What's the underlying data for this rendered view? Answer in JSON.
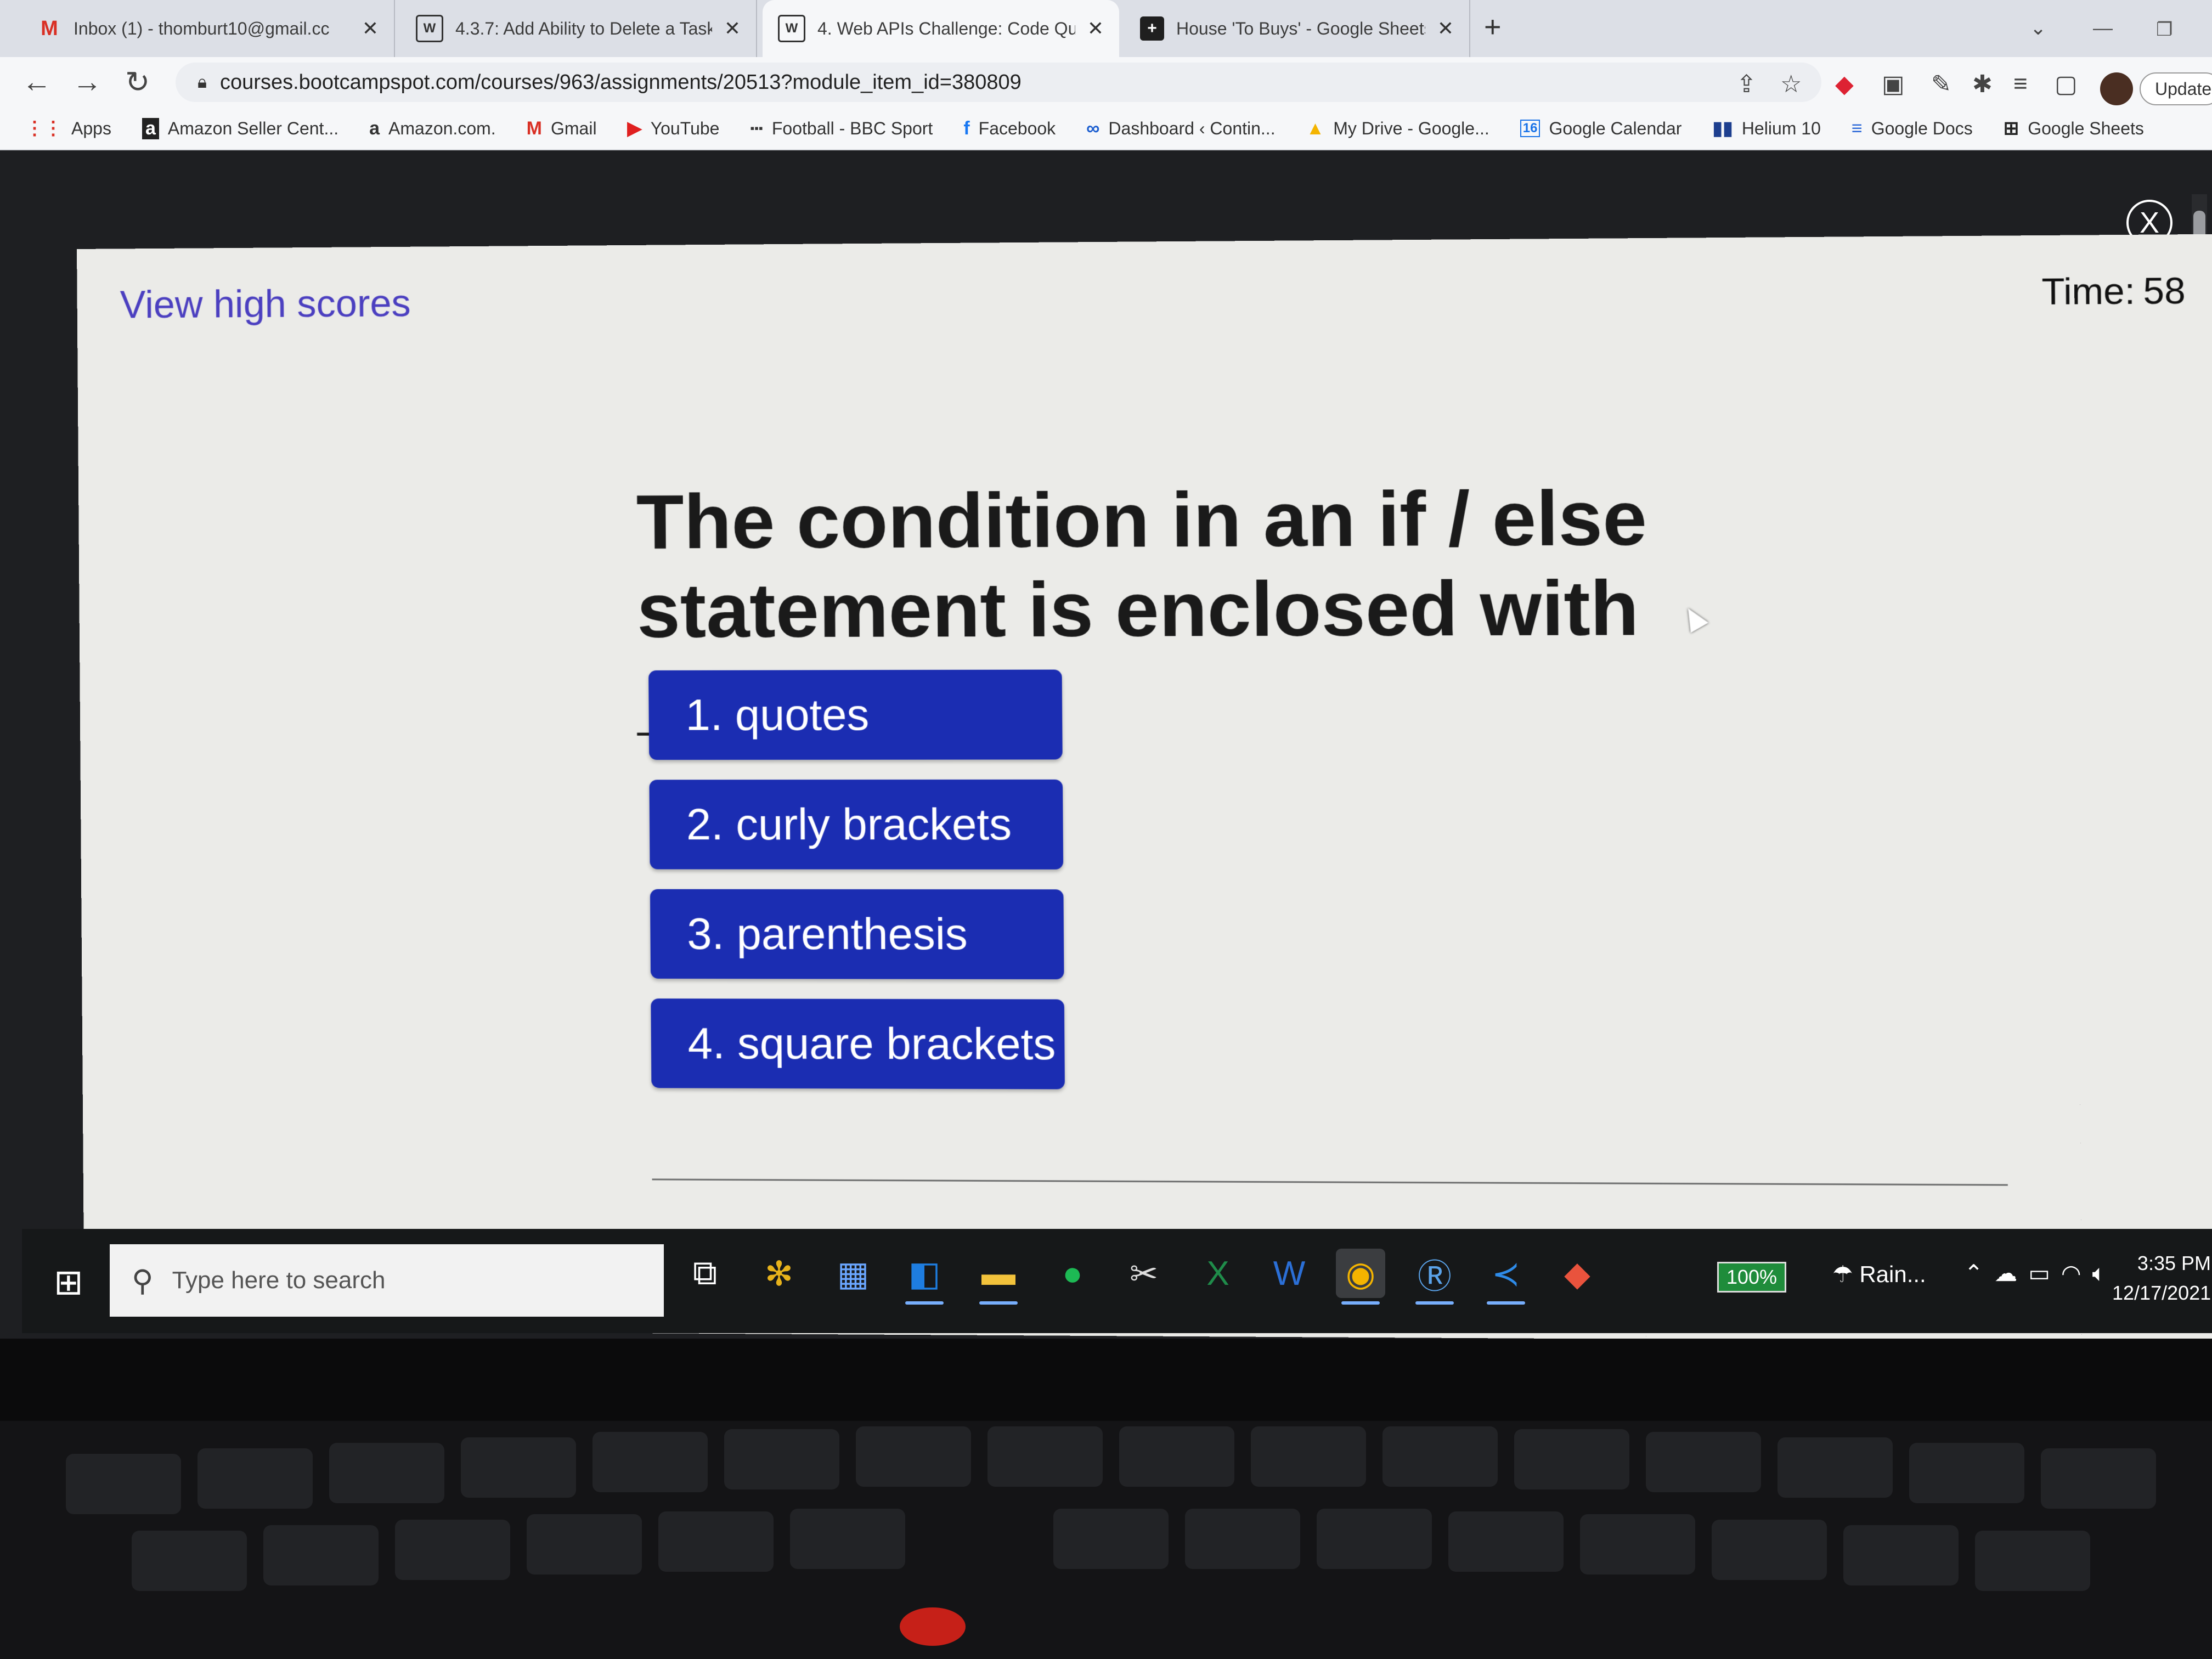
{
  "browser": {
    "tabs": [
      {
        "favicon": "gmail-icon",
        "title": "Inbox (1) - thomburt10@gmail.cc",
        "active": false
      },
      {
        "favicon": "bootcamp-icon",
        "title": "4.3.7: Add Ability to Delete a Task",
        "active": false
      },
      {
        "favicon": "bootcamp-icon",
        "title": "4. Web APIs Challenge: Code Qui",
        "active": true
      },
      {
        "favicon": "sheets-icon",
        "title": "House 'To Buys' - Google Sheets",
        "active": false
      }
    ],
    "new_tab": "+",
    "url": "courses.bootcampspot.com/courses/963/assignments/20513?module_item_id=380809",
    "update_label": "Update",
    "bookmarks": [
      {
        "icon": "apps-grid-icon",
        "glyph": "⋮⋮",
        "label": "Apps"
      },
      {
        "icon": "amazon-seller-icon",
        "glyph": "a",
        "label": "Amazon Seller Cent..."
      },
      {
        "icon": "amazon-icon",
        "glyph": "a",
        "label": "Amazon.com."
      },
      {
        "icon": "gmail-icon",
        "glyph": "M",
        "label": "Gmail"
      },
      {
        "icon": "youtube-icon",
        "glyph": "▶",
        "label": "YouTube"
      },
      {
        "icon": "bbc-icon",
        "glyph": "▪▪▪",
        "label": "Football - BBC Sport"
      },
      {
        "icon": "facebook-icon",
        "glyph": "f",
        "label": "Facebook"
      },
      {
        "icon": "dashboard-icon",
        "glyph": "∞",
        "label": "Dashboard ‹ Contin..."
      },
      {
        "icon": "drive-icon",
        "glyph": "▲",
        "label": "My Drive - Google..."
      },
      {
        "icon": "calendar-icon",
        "glyph": "16",
        "label": "Google Calendar"
      },
      {
        "icon": "helium-icon",
        "glyph": "▮▮",
        "label": "Helium 10"
      },
      {
        "icon": "docs-icon",
        "glyph": "≡",
        "label": "Google Docs"
      },
      {
        "icon": "sheets-icon",
        "glyph": "⊞",
        "label": "Google Sheets"
      }
    ]
  },
  "quiz": {
    "view_high_scores": "View high scores",
    "timer_label": "Time:",
    "timer_value": "58",
    "question": "The condition in an if / else statement is enclosed with ________.",
    "answers": [
      "1. quotes",
      "2. curly brackets",
      "3. parenthesis",
      "4. square brackets"
    ],
    "close_label": "X"
  },
  "taskbar": {
    "search_placeholder": "Type here to search",
    "battery": "100%",
    "weather": "Rain...",
    "time": "3:35 PM",
    "date": "12/17/2021",
    "apps": [
      "task-view-icon",
      "slack-icon",
      "calculator-icon",
      "outlook-icon",
      "file-explorer-icon",
      "spotify-icon",
      "snipping-tool-icon",
      "excel-icon",
      "word-icon",
      "chrome-icon",
      "r-icon",
      "vscode-icon",
      "git-icon"
    ]
  },
  "colors": {
    "answer_button": "#1b2db2",
    "link": "#4b3fc0",
    "modal_background": "#ebebe8"
  }
}
